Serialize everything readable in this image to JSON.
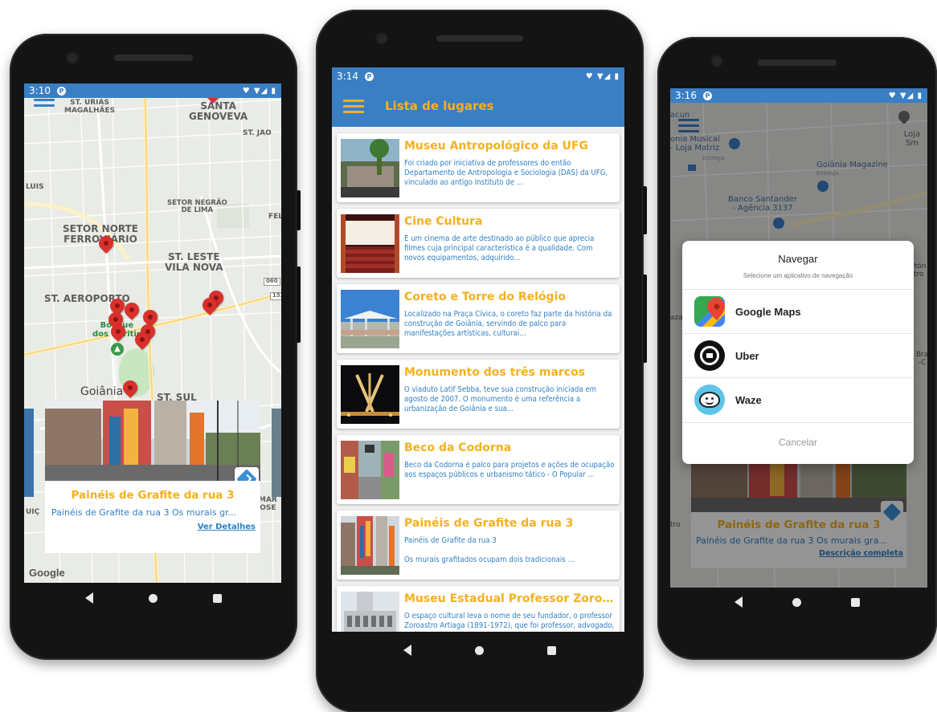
{
  "phone_map": {
    "status": {
      "time": "3:10",
      "icons": "♥ ▼◢ ▮"
    },
    "map_labels": [
      {
        "text": "ST. URIAS\nMAGALHÃES"
      },
      {
        "text": "SANTA\nGENOVEVA"
      },
      {
        "text": "ST. JAO"
      },
      {
        "text": "LUIS"
      },
      {
        "text": "SETOR NEGRÃO\nDE LIMA"
      },
      {
        "text": "FEL"
      },
      {
        "text": "SETOR NORTE\nFERROVIÁRIO"
      },
      {
        "text": "ST. LESTE\nVILA NOVA"
      },
      {
        "text": "ST. AEROPORTO"
      },
      {
        "text": "Bosque\ndos Buritis"
      },
      {
        "text": "Goiânia"
      },
      {
        "text": "ST. SUL"
      },
      {
        "text": "MAR\nOSE"
      },
      {
        "text": "UIÇ"
      },
      {
        "text": "060"
      },
      {
        "text": "153"
      }
    ],
    "card": {
      "title": "Painéis de Grafite da rua 3",
      "subtitle": "Painéis de Grafite da rua 3   Os murais gr...",
      "details_link": "Ver Detalhes"
    },
    "google_logo": "Google",
    "icons": {
      "menu": "hamburger-icon",
      "directions": "directions-icon"
    }
  },
  "phone_list": {
    "status": {
      "time": "3:14",
      "icons": "♥ ▼◢ ▮"
    },
    "app_title": "Lista de lugares",
    "items": [
      {
        "title": "Museu Antropológico da UFG",
        "desc": "Foi criado por iniciativa de professores do então Departamento de Antropologia e Sociologia (DAS) da UFG, vinculado ao antigo Instituto de ..."
      },
      {
        "title": "Cine Cultura",
        "desc": "É um cinema de arte destinado ao público que aprecia filmes cuja principal característica é a qualidade. Com novos equipamentos, adquirido..."
      },
      {
        "title": "Coreto e Torre do Relógio",
        "desc": "Localizado na Praça Cívica, o coreto faz parte da história da construção de Goiânia, servindo de palco para manifestações artísticas, culturai..."
      },
      {
        "title": "Monumento dos três marcos",
        "desc": "O viaduto Latif Sebba, teve sua construção iniciada em agosto de 2007. O monumento é uma referência a urbanização de Goiânia e sua..."
      },
      {
        "title": "Beco da Codorna",
        "desc": "Beco da Codorna é palco para projetos e ações de ocupação aos espaços públicos e urbanismo tático - O Popular ..."
      },
      {
        "title": "Painéis de Grafite da rua 3",
        "desc": "Painéis de Grafite da rua 3\n\nOs murais grafitados ocupam dois tradicionais ..."
      },
      {
        "title": "Museu Estadual Professor Zoroast...",
        "desc": "O espaço cultural leva o nome de seu fundador, o professor Zoroastro Artiaga (1891-1972), que foi professor, advogado, geólogo e historiador e..."
      }
    ]
  },
  "phone_dialog": {
    "status": {
      "time": "3:16",
      "icons": "♥ ▼◢ ▮"
    },
    "bg_labels": [
      {
        "text": "acun"
      },
      {
        "text": "onia Musical\n- Loja Matriz"
      },
      {
        "text": "Entrega"
      },
      {
        "text": "Loja Sm"
      },
      {
        "text": "Goiânia Magazine"
      },
      {
        "text": "Entrega"
      },
      {
        "text": "Banco Santander\n- Agência 3137"
      },
      {
        "text": "aza"
      },
      {
        "text": "rtón\ntro"
      },
      {
        "text": "Bra\n-C"
      },
      {
        "text": "tro"
      }
    ],
    "dialog": {
      "title": "Navegar",
      "subtitle": "Selecione um aplicativo de navegação",
      "options": [
        {
          "label": "Google Maps",
          "icon": "google-maps-icon"
        },
        {
          "label": "Uber",
          "icon": "uber-icon"
        },
        {
          "label": "Waze",
          "icon": "waze-icon"
        }
      ],
      "cancel": "Cancelar"
    },
    "card": {
      "title": "Painéis de Grafite da rua 3",
      "subtitle": "Painéis de Grafite da rua 3   Os murais gra...",
      "details_link": "Descrição completa"
    }
  },
  "colors": {
    "primary_blue": "#3a7fc4",
    "title_yellow": "#f5b01f",
    "desc_blue": "#2f7fc4",
    "pin_red": "#d9302c"
  }
}
